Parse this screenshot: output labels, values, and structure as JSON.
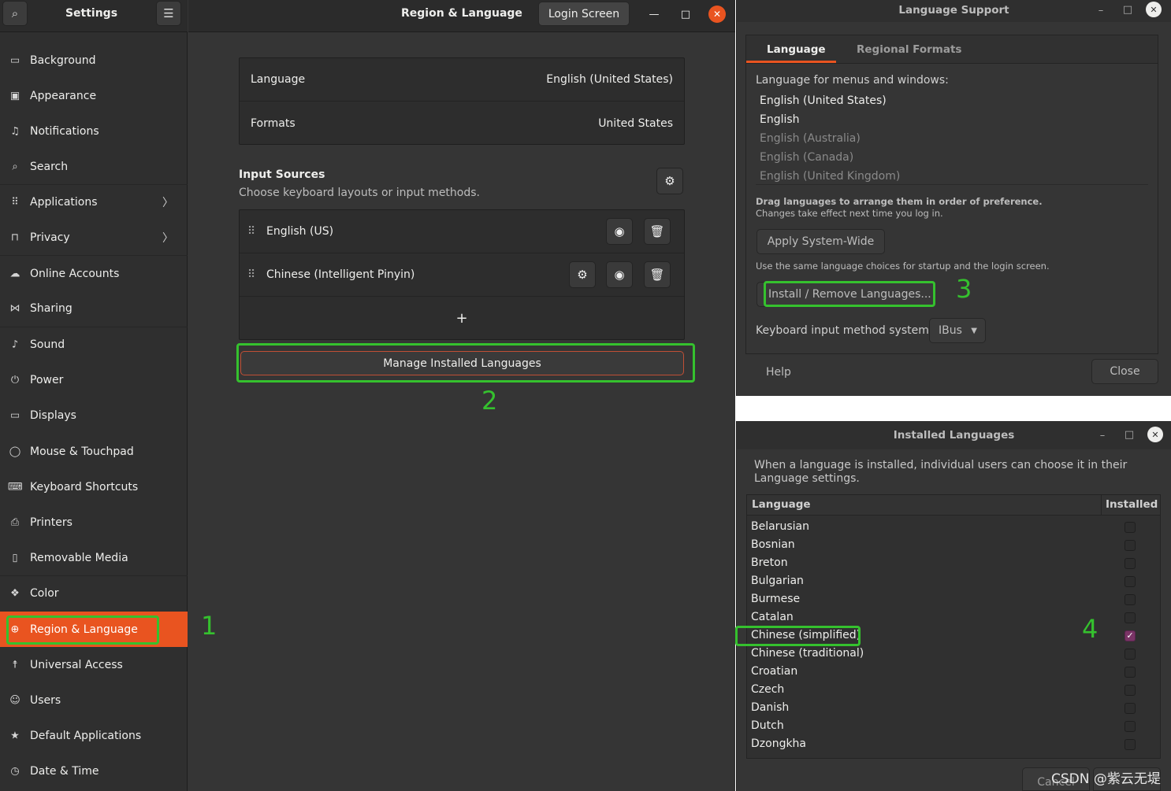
{
  "settings": {
    "sidebar_title": "Settings",
    "main_title": "Region & Language",
    "login_screen_label": "Login Screen",
    "items": [
      {
        "label": "Background",
        "icon": "background-icon",
        "glyph": "▭"
      },
      {
        "label": "Appearance",
        "icon": "appearance-icon",
        "glyph": "▣"
      },
      {
        "label": "Notifications",
        "icon": "bell-icon",
        "glyph": "♫"
      },
      {
        "label": "Search",
        "icon": "search-icon",
        "glyph": "⌕"
      },
      {
        "label": "Applications",
        "icon": "apps-grid-icon",
        "glyph": "⠿",
        "chevron": "〉"
      },
      {
        "label": "Privacy",
        "icon": "lock-icon",
        "glyph": "⊓",
        "chevron": "〉"
      },
      {
        "label": "Online Accounts",
        "icon": "cloud-icon",
        "glyph": "☁"
      },
      {
        "label": "Sharing",
        "icon": "share-icon",
        "glyph": "⋈"
      },
      {
        "label": "Sound",
        "icon": "music-note-icon",
        "glyph": "♪"
      },
      {
        "label": "Power",
        "icon": "power-icon",
        "glyph": "⏻"
      },
      {
        "label": "Displays",
        "icon": "display-icon",
        "glyph": "▭"
      },
      {
        "label": "Mouse & Touchpad",
        "icon": "mouse-icon",
        "glyph": "◯"
      },
      {
        "label": "Keyboard Shortcuts",
        "icon": "keyboard-icon",
        "glyph": "⌨"
      },
      {
        "label": "Printers",
        "icon": "printer-icon",
        "glyph": "⎙"
      },
      {
        "label": "Removable Media",
        "icon": "usb-drive-icon",
        "glyph": "▯"
      },
      {
        "label": "Color",
        "icon": "color-icon",
        "glyph": "❖"
      },
      {
        "label": "Region & Language",
        "icon": "globe-icon",
        "glyph": "⊕"
      },
      {
        "label": "Universal Access",
        "icon": "accessibility-icon",
        "glyph": "☨"
      },
      {
        "label": "Users",
        "icon": "users-icon",
        "glyph": "☺"
      },
      {
        "label": "Default Applications",
        "icon": "star-icon",
        "glyph": "★"
      },
      {
        "label": "Date & Time",
        "icon": "clock-icon",
        "glyph": "◷"
      }
    ],
    "language_label": "Language",
    "language_value": "English (United States)",
    "formats_label": "Formats",
    "formats_value": "United States",
    "input_sources_title": "Input Sources",
    "input_sources_subtitle": "Choose keyboard layouts or input methods.",
    "input_sources": [
      "English (US)",
      "Chinese (Intelligent Pinyin)"
    ],
    "add_glyph": "+",
    "manage_button": "Manage Installed Languages"
  },
  "language_support": {
    "title": "Language Support",
    "tabs": [
      "Language",
      "Regional Formats"
    ],
    "menus_label": "Language for menus and windows:",
    "languages": [
      "English (United States)",
      "English",
      "English (Australia)",
      "English (Canada)",
      "English (United Kingdom)"
    ],
    "drag_hint": "Drag languages to arrange them in order of preference.",
    "changes_hint": "Changes take effect next time you log in.",
    "apply_button": "Apply System-Wide",
    "startup_hint": "Use the same language choices for startup and the login screen.",
    "install_button": "Install / Remove Languages...",
    "im_label": "Keyboard input method system:",
    "im_value": "IBus",
    "help_button": "Help",
    "close_button": "Close"
  },
  "installed_languages": {
    "title": "Installed Languages",
    "description": "When a language is installed, individual users can choose it in their Language settings.",
    "col_language": "Language",
    "col_installed": "Installed",
    "rows": [
      {
        "name": "Belarusian",
        "installed": false
      },
      {
        "name": "Bosnian",
        "installed": false
      },
      {
        "name": "Breton",
        "installed": false
      },
      {
        "name": "Bulgarian",
        "installed": false
      },
      {
        "name": "Burmese",
        "installed": false
      },
      {
        "name": "Catalan",
        "installed": false
      },
      {
        "name": "Chinese (simplified)",
        "installed": true
      },
      {
        "name": "Chinese (traditional)",
        "installed": false
      },
      {
        "name": "Croatian",
        "installed": false
      },
      {
        "name": "Czech",
        "installed": false
      },
      {
        "name": "Danish",
        "installed": false
      },
      {
        "name": "Dutch",
        "installed": false
      },
      {
        "name": "Dzongkha",
        "installed": false
      }
    ],
    "cancel_button": "Cancel"
  },
  "annotations": [
    "1",
    "2",
    "3",
    "4"
  ],
  "watermark": "CSDN @紫云无堤",
  "colors": {
    "accent": "#e95420",
    "annotation": "#35c12e",
    "check": "#7a3466"
  }
}
